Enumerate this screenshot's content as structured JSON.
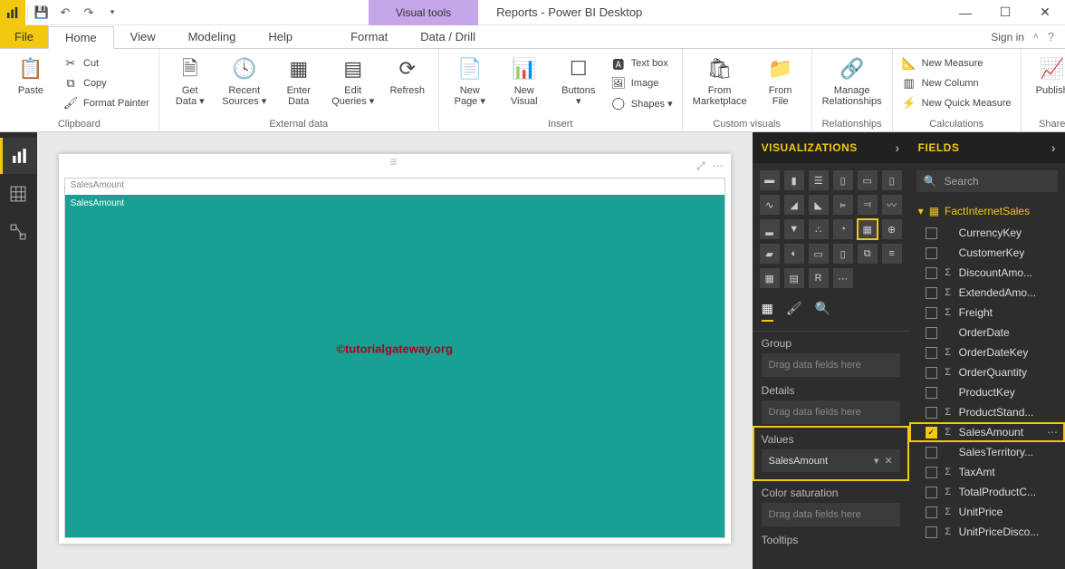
{
  "window": {
    "title": "Reports - Power BI Desktop",
    "visual_tools": "Visual tools",
    "signin": "Sign in"
  },
  "tabs": {
    "file": "File",
    "home": "Home",
    "view": "View",
    "modeling": "Modeling",
    "help": "Help",
    "format": "Format",
    "data_drill": "Data / Drill"
  },
  "ribbon": {
    "clipboard": {
      "label": "Clipboard",
      "paste": "Paste",
      "cut": "Cut",
      "copy": "Copy",
      "format_painter": "Format Painter"
    },
    "external": {
      "label": "External data",
      "get_data": "Get\nData ▾",
      "recent_sources": "Recent\nSources ▾",
      "enter_data": "Enter\nData",
      "edit_queries": "Edit\nQueries ▾",
      "refresh": "Refresh"
    },
    "insert": {
      "label": "Insert",
      "new_page": "New\nPage ▾",
      "new_visual": "New\nVisual",
      "buttons": "Buttons\n▾",
      "text_box": "Text box",
      "image": "Image",
      "shapes": "Shapes ▾"
    },
    "custom": {
      "label": "Custom visuals",
      "from_marketplace": "From\nMarketplace",
      "from_file": "From\nFile"
    },
    "relationships": {
      "label": "Relationships",
      "manage": "Manage\nRelationships"
    },
    "calculations": {
      "label": "Calculations",
      "new_measure": "New Measure",
      "new_column": "New Column",
      "new_quick_measure": "New Quick Measure"
    },
    "share": {
      "label": "Share",
      "publish": "Publish"
    }
  },
  "canvas": {
    "tile_header": "SalesAmount",
    "tile_inner": "SalesAmount",
    "watermark": "©tutorialgateway.org"
  },
  "vis_pane": {
    "title": "VISUALIZATIONS",
    "wells": {
      "group": "Group",
      "details": "Details",
      "values": "Values",
      "color_sat": "Color saturation",
      "tooltips": "Tooltips",
      "placeholder": "Drag data fields here",
      "value_field": "SalesAmount"
    }
  },
  "fields_pane": {
    "title": "FIELDS",
    "search": "Search",
    "table": "FactInternetSales",
    "fields": [
      {
        "name": "CurrencyKey",
        "sigma": false,
        "checked": false
      },
      {
        "name": "CustomerKey",
        "sigma": false,
        "checked": false
      },
      {
        "name": "DiscountAmo...",
        "sigma": true,
        "checked": false
      },
      {
        "name": "ExtendedAmo...",
        "sigma": true,
        "checked": false
      },
      {
        "name": "Freight",
        "sigma": true,
        "checked": false
      },
      {
        "name": "OrderDate",
        "sigma": false,
        "checked": false
      },
      {
        "name": "OrderDateKey",
        "sigma": true,
        "checked": false
      },
      {
        "name": "OrderQuantity",
        "sigma": true,
        "checked": false
      },
      {
        "name": "ProductKey",
        "sigma": false,
        "checked": false
      },
      {
        "name": "ProductStand...",
        "sigma": true,
        "checked": false
      },
      {
        "name": "SalesAmount",
        "sigma": true,
        "checked": true,
        "selected": true
      },
      {
        "name": "SalesTerritory...",
        "sigma": false,
        "checked": false
      },
      {
        "name": "TaxAmt",
        "sigma": true,
        "checked": false
      },
      {
        "name": "TotalProductC...",
        "sigma": true,
        "checked": false
      },
      {
        "name": "UnitPrice",
        "sigma": true,
        "checked": false
      },
      {
        "name": "UnitPriceDisco...",
        "sigma": true,
        "checked": false
      }
    ]
  }
}
